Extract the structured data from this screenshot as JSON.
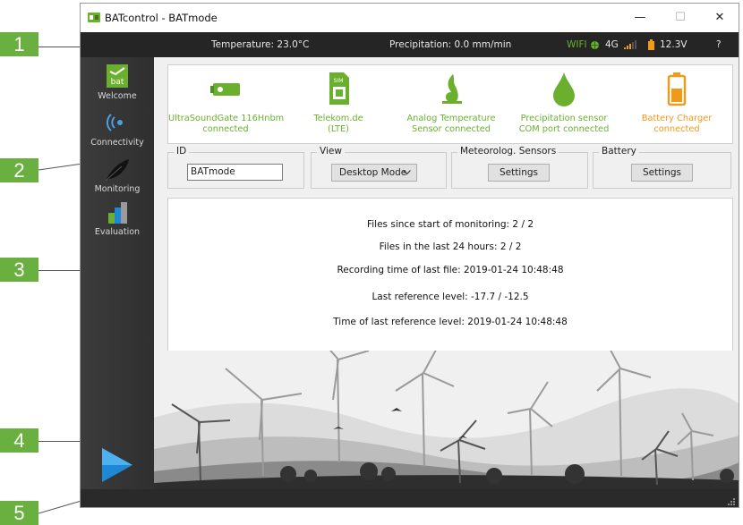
{
  "window": {
    "title": "BATcontrol - BATmode",
    "minimize": "—",
    "maximize": "☐",
    "close": "✕"
  },
  "statusbar": {
    "temperature": "Temperature: 23.0°C",
    "precipitation": "Precipitation: 0.0 mm/min",
    "wifi": "WIFI",
    "network": "4G",
    "voltage": "12.3V",
    "help": "?"
  },
  "sidebar": {
    "items": [
      {
        "label": "Welcome",
        "icon": "bat-logo-icon"
      },
      {
        "label": "Connectivity",
        "icon": "wireless-icon"
      },
      {
        "label": "Monitoring",
        "icon": "feather-icon"
      },
      {
        "label": "Evaluation",
        "icon": "bar-chart-icon"
      }
    ]
  },
  "devices": [
    {
      "name": "UltraSoundGate 116Hnbm",
      "status": "connected",
      "color": "#6ab02e",
      "icon": "ultrasound-device-icon"
    },
    {
      "name": "Telekom.de",
      "status": "(LTE)",
      "color": "#6ab02e",
      "icon": "sim-card-icon"
    },
    {
      "name": "Analog Temperature",
      "status": "Sensor connected",
      "color": "#6ab02e",
      "icon": "flame-icon"
    },
    {
      "name": "Precipitation sensor",
      "status": "COM port connected",
      "color": "#6ab02e",
      "icon": "drop-icon"
    },
    {
      "name": "Battery Charger",
      "status": "connected",
      "color": "#f09a1c",
      "icon": "battery-icon"
    }
  ],
  "groups": {
    "id": {
      "title": "ID",
      "value": "BATmode"
    },
    "view": {
      "title": "View",
      "value": "Desktop Mode"
    },
    "meteo": {
      "title": "Meteorolog. Sensors",
      "button": "Settings"
    },
    "battery": {
      "title": "Battery",
      "button": "Settings"
    }
  },
  "info": {
    "files_since_start": "Files since start of monitoring: 2 / 2",
    "files_24h": "Files in the last 24 hours: 2 / 2",
    "last_file_time": "Recording time of last file: 2019-01-24 10:48:48",
    "last_ref_level": "Last reference level: -17.7 / -12.5",
    "last_ref_time": "Time of last reference level: 2019-01-24 10:48:48"
  },
  "callouts": [
    "1",
    "2",
    "3",
    "4",
    "5"
  ],
  "colors": {
    "accent_green": "#6ab02e",
    "callout_green": "#6ab041",
    "warning_orange": "#f09a1c",
    "play_blue": "#1e88d6",
    "dark_bar": "#252525"
  }
}
